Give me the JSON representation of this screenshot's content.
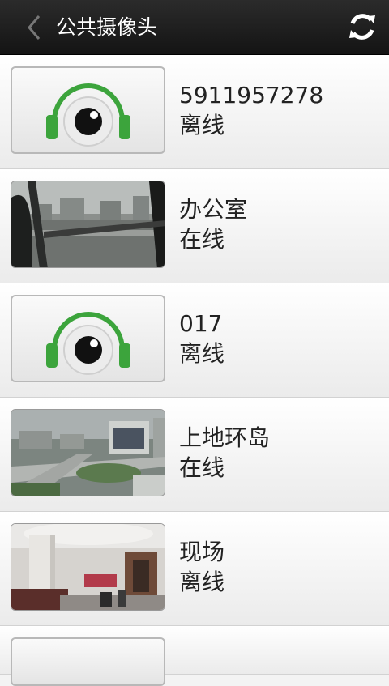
{
  "header": {
    "title": "公共摄像头",
    "back_icon": "chevron-left-icon",
    "refresh_icon": "refresh-icon"
  },
  "cameras": [
    {
      "name": "5911957278",
      "status": "离线",
      "thumbnail": "headphone-eye-placeholder"
    },
    {
      "name": "办公室",
      "status": "在线",
      "thumbnail": "office-window-view"
    },
    {
      "name": "017",
      "status": "离线",
      "thumbnail": "headphone-eye-placeholder"
    },
    {
      "name": "上地环岛",
      "status": "在线",
      "thumbnail": "city-roundabout-view"
    },
    {
      "name": "现场",
      "status": "离线",
      "thumbnail": "lobby-interior-view"
    }
  ],
  "colors": {
    "header": "#1e1e1e",
    "logo_green": "#3ca43c"
  }
}
